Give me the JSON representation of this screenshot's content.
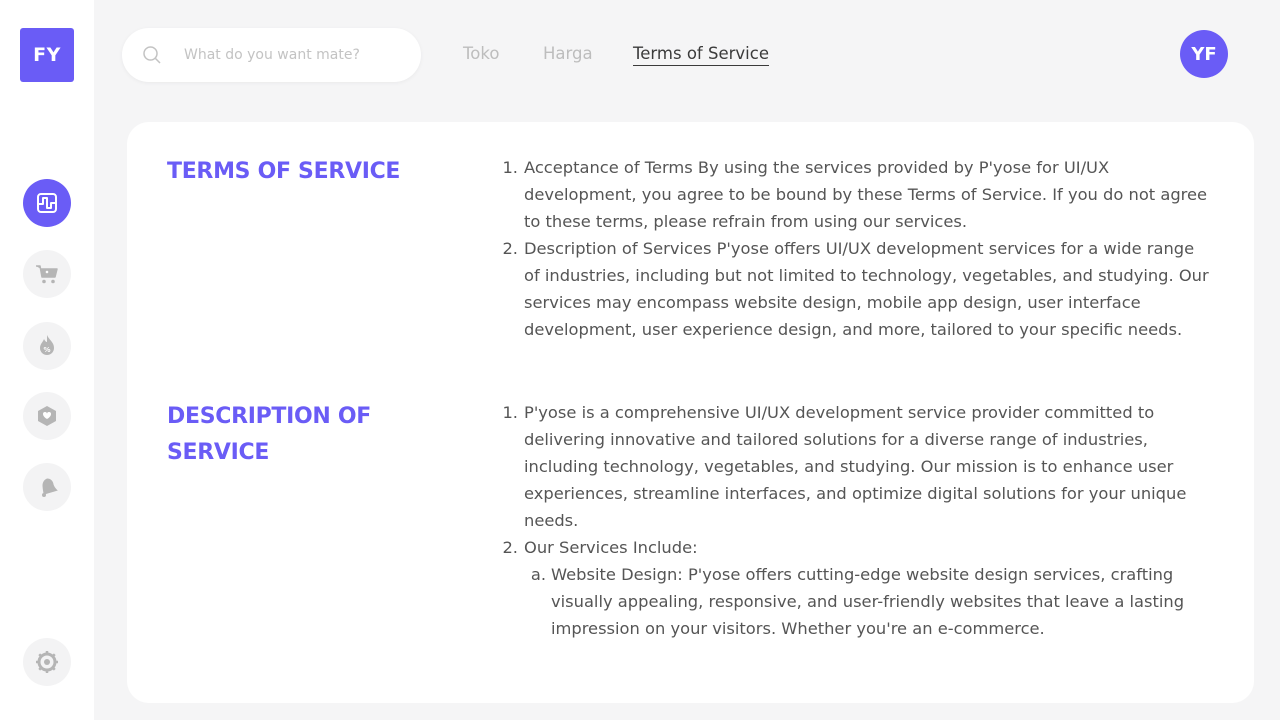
{
  "brand": {
    "initials": "FY",
    "accent": "#6a5cf6"
  },
  "sidebar": {
    "items": [
      {
        "name": "dashboard",
        "icon": "pulse-icon",
        "active": true
      },
      {
        "name": "cart",
        "icon": "cart-icon",
        "active": false
      },
      {
        "name": "promo",
        "icon": "discount-flame-icon",
        "active": false
      },
      {
        "name": "rewards",
        "icon": "gift-box-icon",
        "active": false
      },
      {
        "name": "notifications",
        "icon": "bell-icon",
        "active": false
      }
    ],
    "settings_icon": "gear-icon"
  },
  "search": {
    "placeholder": "What do you want mate?",
    "value": ""
  },
  "tabs": [
    {
      "label": "Toko",
      "active": false
    },
    {
      "label": "Harga",
      "active": false
    },
    {
      "label": "Terms of Service",
      "active": true
    }
  ],
  "user": {
    "initials": "YF"
  },
  "content": {
    "sections": [
      {
        "title": "TERMS OF SERVICE",
        "items": [
          {
            "num": "1.",
            "text": "Acceptance of Terms By using the services provided by P'yose for UI/UX development, you agree to be bound by these Terms of Service. If you do not agree to these terms, please refrain from using our services."
          },
          {
            "num": "2.",
            "text": "Description of Services P'yose offers UI/UX development services for a wide range of industries, including but not limited to technology, vegetables, and studying. Our services may encompass website design, mobile app design, user interface development, user experience design, and more, tailored to your specific needs."
          }
        ]
      },
      {
        "title": "DESCRIPTION OF SERVICE",
        "items": [
          {
            "num": "1.",
            "text": "P'yose is a comprehensive UI/UX development service provider committed to delivering innovative and tailored solutions for a diverse range of industries, including technology, vegetables, and studying. Our mission is to enhance user experiences, streamline interfaces, and optimize digital solutions for your unique needs."
          },
          {
            "num": "2.",
            "text": "Our Services Include:"
          }
        ],
        "subitems": [
          {
            "num": "a.",
            "text": "Website Design: P'yose offers cutting-edge website design services, crafting visually appealing, responsive, and user-friendly websites that leave a lasting impression on your visitors. Whether you're an e-commerce."
          }
        ]
      }
    ]
  }
}
